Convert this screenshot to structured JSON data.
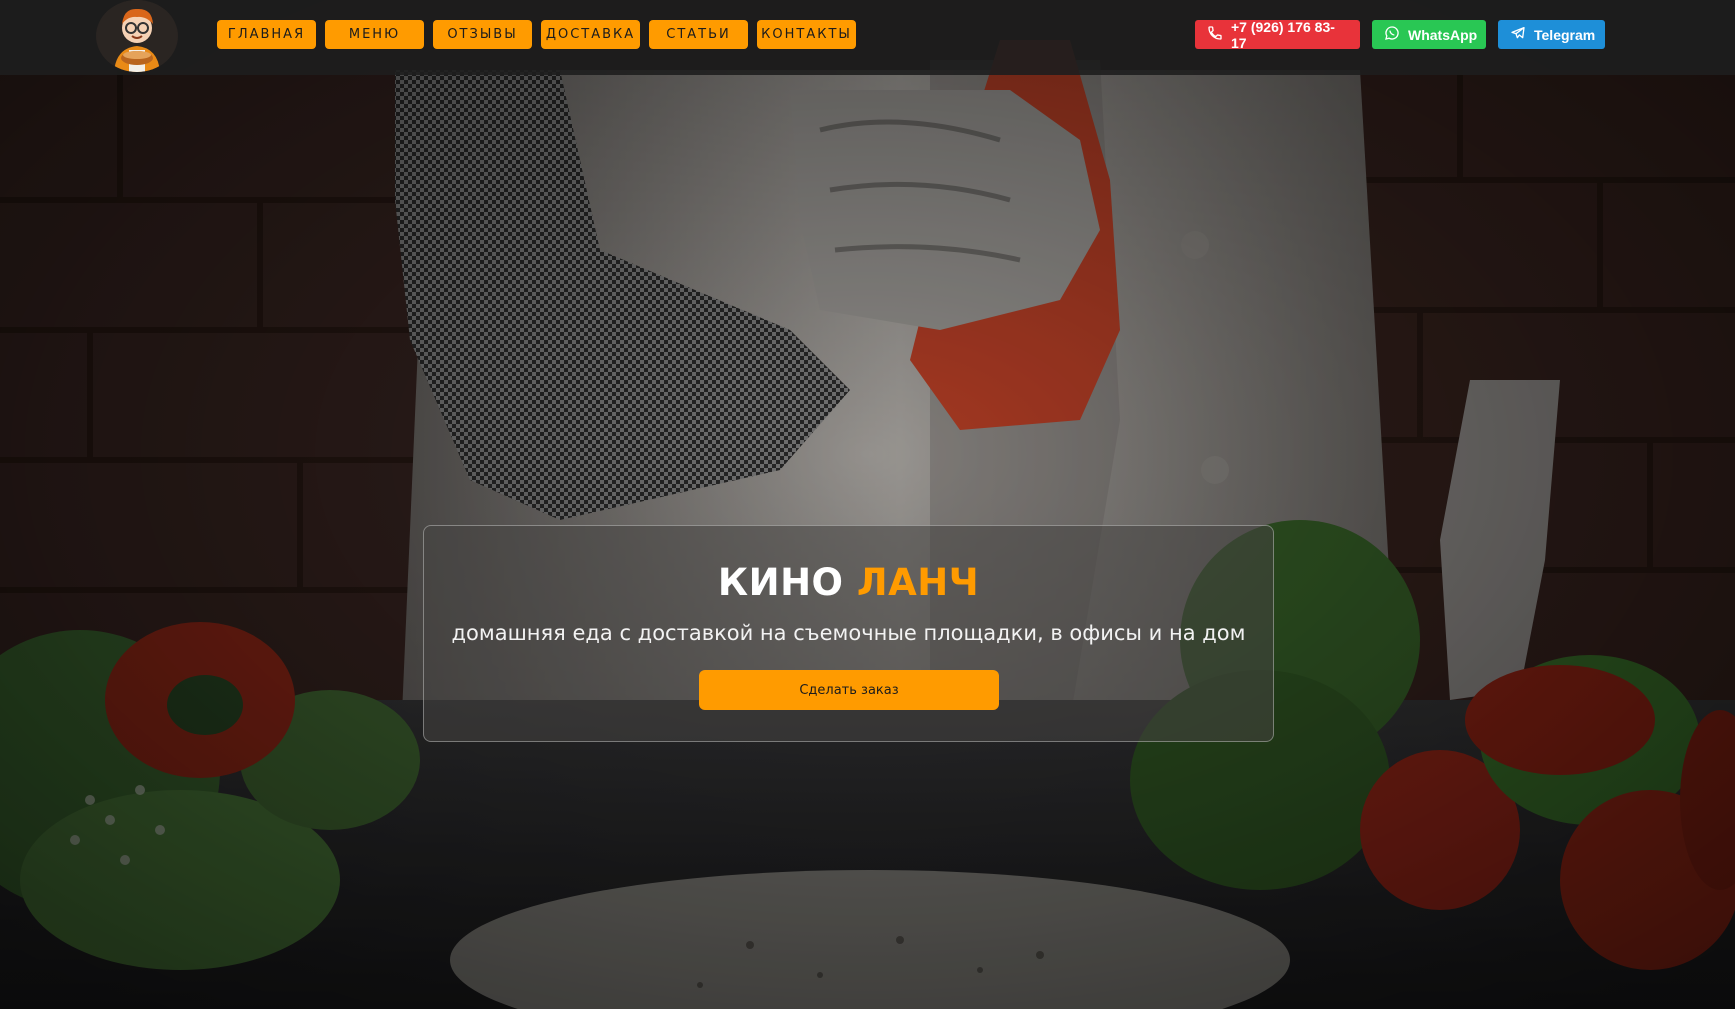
{
  "header": {
    "nav": [
      {
        "label": "ГЛАВНАЯ"
      },
      {
        "label": "МЕНЮ"
      },
      {
        "label": "ОТЗЫВЫ"
      },
      {
        "label": "ДОСТАВКА"
      },
      {
        "label": "СТАТЬИ"
      },
      {
        "label": "КОНТАКТЫ"
      }
    ],
    "contacts": {
      "phone": "+7 (926) 176 83-17",
      "whatsapp": "WhatsApp",
      "telegram": "Telegram"
    },
    "icons": {
      "logo": "chef-mascot-logo",
      "phone": "phone-icon",
      "whatsapp": "whatsapp-icon",
      "telegram": "telegram-icon"
    }
  },
  "hero": {
    "title_part1": "КИНО",
    "title_part2": "ЛАНЧ",
    "subtitle": "домашняя еда с доставкой на съемочные площадки, в офисы и на дом",
    "cta_label": "Сделать заказ"
  },
  "colors": {
    "accent": "#ff9b00",
    "phone_bg": "#e8333a",
    "whatsapp_bg": "#29c754",
    "telegram_bg": "#1e8fd8",
    "topbar_bg": "#1e1e1e"
  }
}
